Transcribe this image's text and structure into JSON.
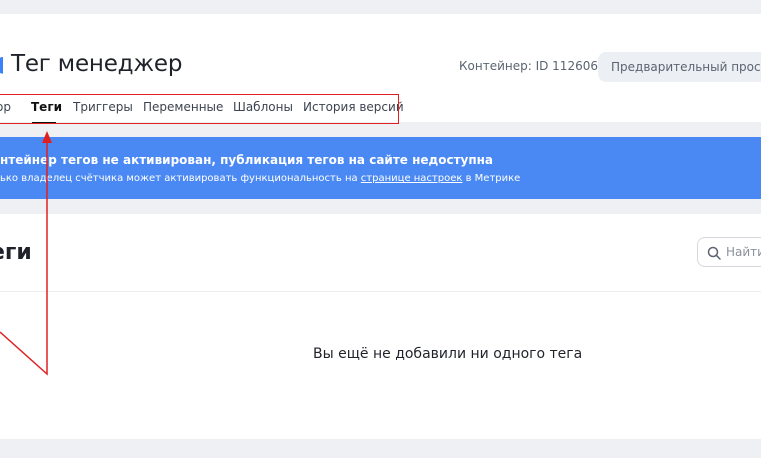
{
  "header": {
    "title": "Тег менеджер",
    "container_id": "Контейнер: ID 112606",
    "preview_button": "Предварительный просмотр"
  },
  "tabs": [
    {
      "label": "ор"
    },
    {
      "label": "Теги",
      "active": true
    },
    {
      "label": "Триггеры"
    },
    {
      "label": "Переменные"
    },
    {
      "label": "Шаблоны"
    },
    {
      "label": "История версий"
    }
  ],
  "banner": {
    "title": "нтейнер тегов не активирован, публикация тегов на сайте недоступна",
    "text_before": "ько владелец счётчика может активировать функциональность на ",
    "link": "странице настроек",
    "text_after": " в Метрике",
    "color": "#4a89f3"
  },
  "main": {
    "section_title": "еги",
    "search_placeholder": "Найти",
    "empty_state": "Вы ещё не добавили ни одного тега"
  },
  "annotation_color": "#e02020"
}
